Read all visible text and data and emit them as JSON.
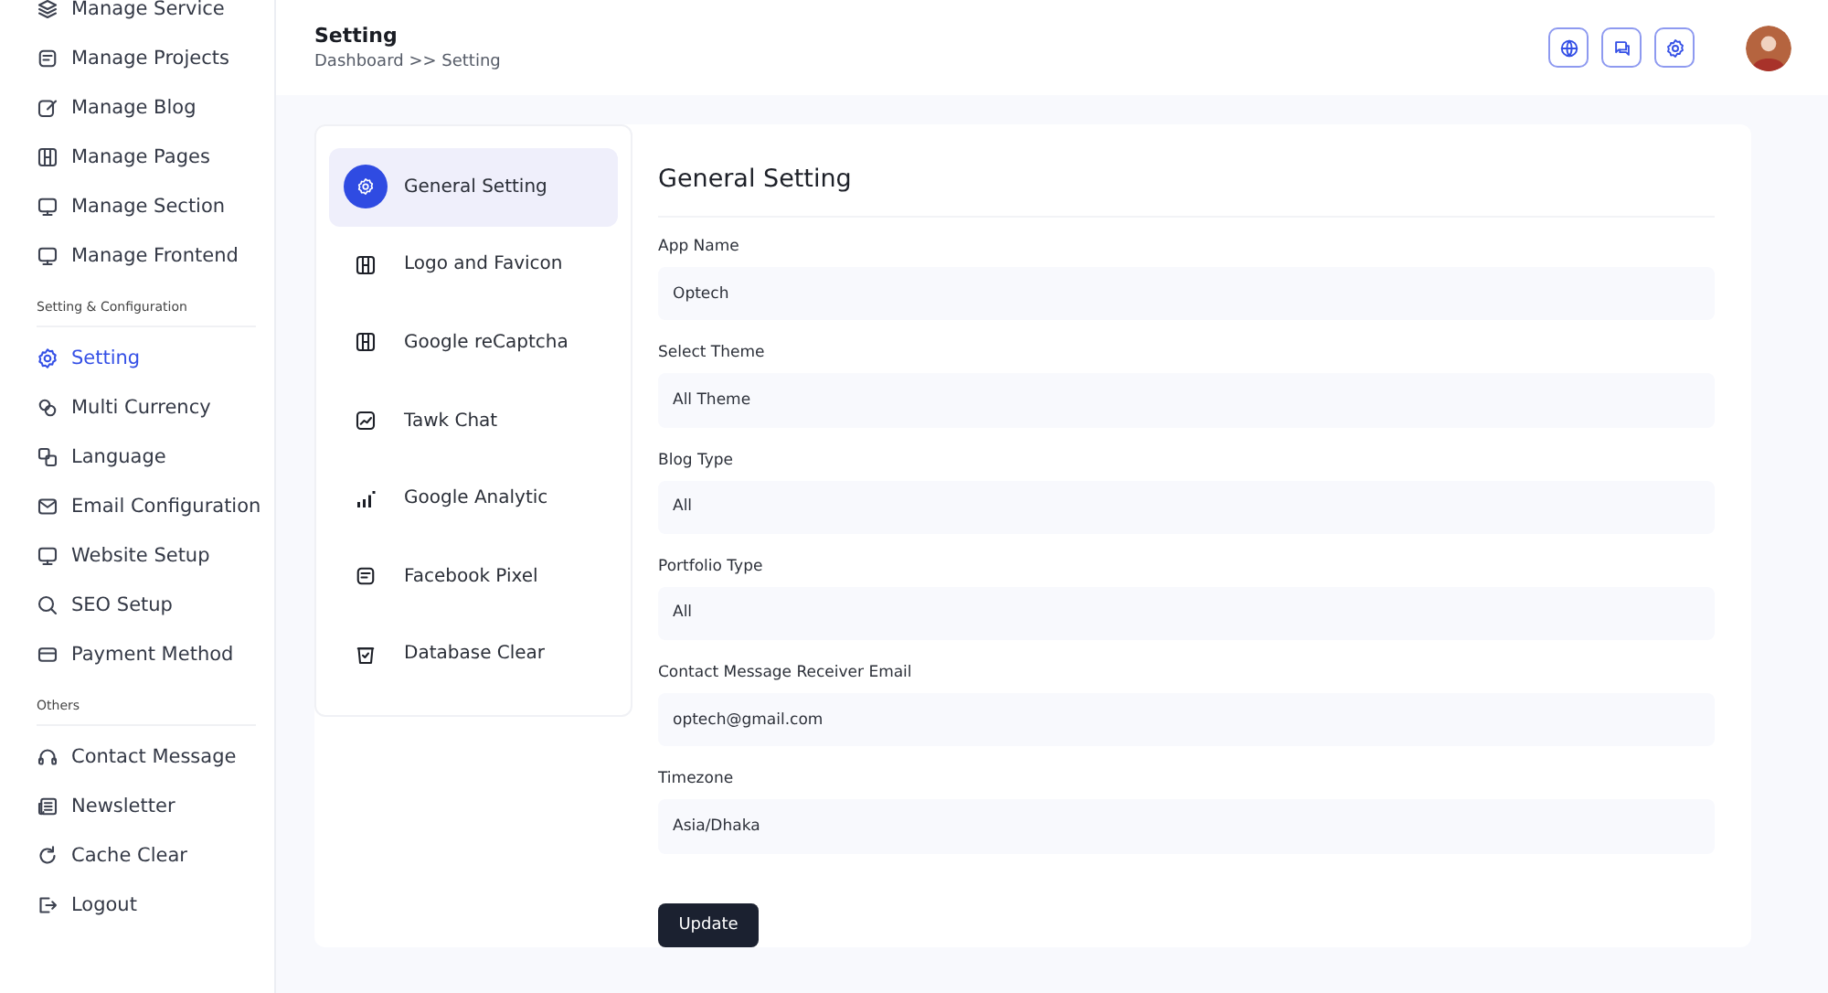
{
  "sidebar": {
    "items": [
      {
        "kind": "link",
        "label": "Manage Service",
        "selected": false
      },
      {
        "kind": "link",
        "label": "Manage Projects",
        "selected": false
      },
      {
        "kind": "link",
        "label": "Manage Blog",
        "selected": false
      },
      {
        "kind": "link",
        "label": "Manage Pages",
        "selected": false
      },
      {
        "kind": "link",
        "label": "Manage Section",
        "selected": false
      },
      {
        "kind": "link",
        "label": "Manage Frontend",
        "selected": false
      },
      {
        "kind": "heading",
        "label": "Setting & Configuration"
      },
      {
        "kind": "link",
        "label": "Setting",
        "selected": true
      },
      {
        "kind": "link",
        "label": "Multi Currency",
        "selected": false
      },
      {
        "kind": "link",
        "label": "Language",
        "selected": false
      },
      {
        "kind": "link",
        "label": "Email Configuration",
        "selected": false
      },
      {
        "kind": "link",
        "label": "Website Setup",
        "selected": false
      },
      {
        "kind": "link",
        "label": "SEO Setup",
        "selected": false
      },
      {
        "kind": "link",
        "label": "Payment Method",
        "selected": false
      },
      {
        "kind": "heading",
        "label": "Others"
      },
      {
        "kind": "link",
        "label": "Contact Message",
        "selected": false
      },
      {
        "kind": "link",
        "label": "Newsletter",
        "selected": false
      },
      {
        "kind": "link",
        "label": "Cache Clear",
        "selected": false
      },
      {
        "kind": "link",
        "label": "Logout",
        "selected": false
      }
    ]
  },
  "header": {
    "title": "Setting",
    "breadcrumb": "Dashboard >> Setting"
  },
  "settings_menu": [
    {
      "label": "General Setting",
      "selected": true
    },
    {
      "label": "Logo and Favicon",
      "selected": false
    },
    {
      "label": "Google reCaptcha",
      "selected": false
    },
    {
      "label": "Tawk Chat",
      "selected": false
    },
    {
      "label": "Google Analytic",
      "selected": false
    },
    {
      "label": "Facebook Pixel",
      "selected": false
    },
    {
      "label": "Database Clear",
      "selected": false
    }
  ],
  "form": {
    "title": "General Setting",
    "fields": [
      {
        "label": "App Name",
        "value": "Optech"
      },
      {
        "label": "Select Theme",
        "value": "All Theme"
      },
      {
        "label": "Blog Type",
        "value": "All"
      },
      {
        "label": "Portfolio Type",
        "value": "All"
      },
      {
        "label": "Contact Message Receiver Email",
        "value": "optech@gmail.com"
      },
      {
        "label": "Timezone",
        "value": "Asia/Dhaka"
      }
    ],
    "button": "Update"
  }
}
